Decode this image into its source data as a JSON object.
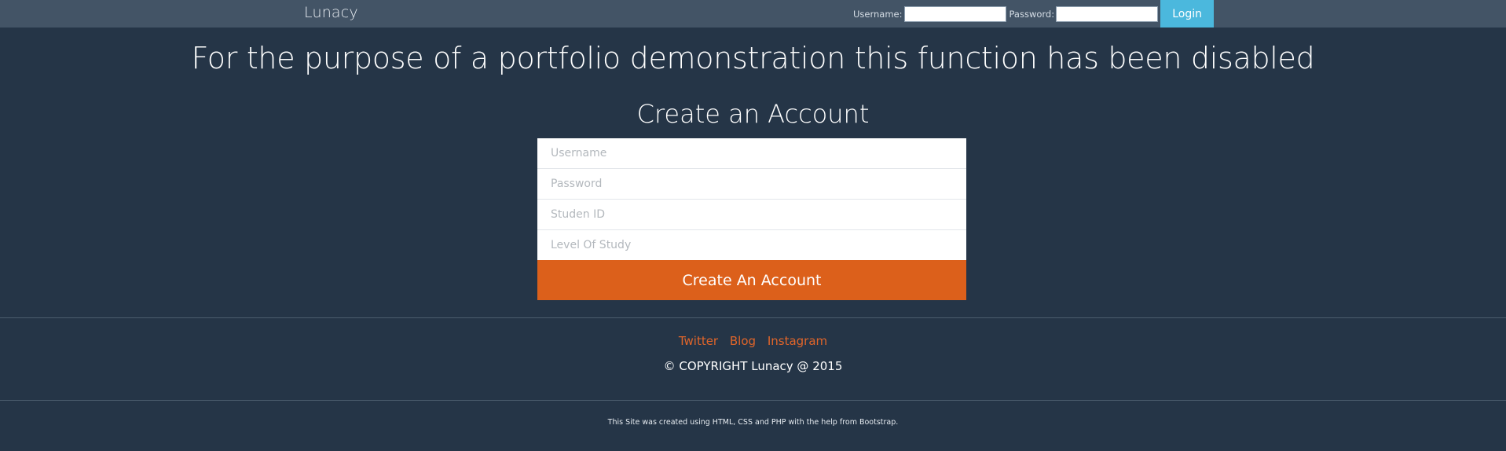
{
  "navbar": {
    "brand": "Lunacy",
    "username_label": "Username:",
    "password_label": "Password:",
    "username_value": "",
    "password_value": "",
    "login_label": "Login",
    "login_color": "#4bb8dd"
  },
  "notice": "For the purpose of a portfolio demonstration this function has been disabled",
  "signup": {
    "title": "Create an Account",
    "fields": [
      {
        "placeholder": "Username",
        "value": ""
      },
      {
        "placeholder": "Password",
        "value": ""
      },
      {
        "placeholder": "Studen ID",
        "value": ""
      },
      {
        "placeholder": "Level Of Study",
        "value": ""
      }
    ],
    "submit_label": "Create An Account",
    "submit_color": "#dc601b"
  },
  "footer": {
    "links": [
      "Twitter",
      "Blog",
      "Instagram"
    ],
    "link_color": "#e0652a",
    "copyright": "© COPYRIGHT Lunacy @ 2015",
    "credits": "This Site was created using HTML, CSS and PHP with the help from Bootstrap."
  },
  "colors": {
    "background": "#253547",
    "navbar": "#435466"
  }
}
